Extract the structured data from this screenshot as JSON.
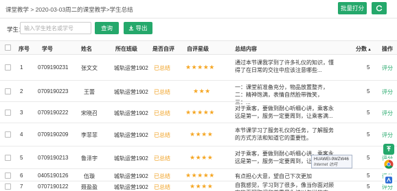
{
  "breadcrumb": "课堂教学 > 2020-03-03周二的课堂教学>学生总结",
  "toolbar": {
    "batch_score_label": "批量打分",
    "refresh_icon": "refresh-icon"
  },
  "search": {
    "label": "学生：",
    "placeholder": "输入学生姓名或学号",
    "query_label": "查询",
    "export_label": "导出"
  },
  "table": {
    "columns": [
      "序号",
      "学号",
      "姓名",
      "所在班级",
      "是否自评",
      "自评星级",
      "总结内容",
      "分数",
      "操作"
    ],
    "sort_column": "分数",
    "rows": [
      {
        "index": "1",
        "student_id": "0709190231",
        "name": "张文文",
        "class": "城轨运营1902",
        "self_eval": "已总结",
        "stars": "★★★★★",
        "summary": "通过本节课我学到了许多礼仪的知识，懂得了在日常的交往中应该注意哪些...",
        "score": "5",
        "action": "评分"
      },
      {
        "index": "2",
        "student_id": "0709190223",
        "name": "王蕾",
        "class": "城轨运营1902",
        "self_eval": "已总结",
        "stars": "★★★",
        "summary": "一：课堂前准备充分，物品放置整齐，二：精神饱满，表情自然脸带微笑，三：...",
        "score": "5",
        "action": "评分"
      },
      {
        "index": "3",
        "student_id": "0709190222",
        "name": "宋晓召",
        "class": "城轨运营1902",
        "self_eval": "已总结",
        "stars": "★★★★★",
        "summary": "对于乘客，要做到耐心听细心讲，乘客永远是第一，服务一定要周到，让乘客满...",
        "score": "5",
        "action": "评分"
      },
      {
        "index": "4",
        "student_id": "0709190209",
        "name": "李菲菲",
        "class": "城轨运营1902",
        "self_eval": "已总结",
        "stars": "★★★★",
        "summary": "本节课学习了服务礼仪的任务，了解服务的方式方法和知道它的重要性。",
        "score": "5",
        "action": "评分"
      },
      {
        "index": "5",
        "student_id": "0709190213",
        "name": "鲁泽宇",
        "class": "城轨运营1902",
        "self_eval": "已总结",
        "stars": "★★★★",
        "summary": "对于乘客，要做到耐心听细心讲，乘客永远是第一，服务一定要周到，让乘客满...",
        "score": "5",
        "action": "评分"
      },
      {
        "index": "6",
        "student_id": "0405190126",
        "name": "伍璇",
        "class": "城轨运营1902",
        "self_eval": "已总结",
        "stars": "★★★★★",
        "summary": "有点担心大意，望自己下次更加认真",
        "score": "5",
        "action": "评分"
      },
      {
        "index": "7",
        "student_id": "0707190122",
        "name": "聂盈盈",
        "class": "城轨运营1902",
        "self_eval": "已总结",
        "stars": "★★★★",
        "summary": "自我感觉，学习到了很多，像当你面对顾客的无理取闹和尊重是你该以怎样的态...",
        "score": "5",
        "action": "评分"
      }
    ]
  },
  "tooltip": {
    "title": "HUAWEI-9WZW46",
    "subtitle": "Internet 访问"
  },
  "colors": {
    "accent": "#25a86b",
    "star": "#f5a623",
    "evaluated": "#f0a020"
  }
}
